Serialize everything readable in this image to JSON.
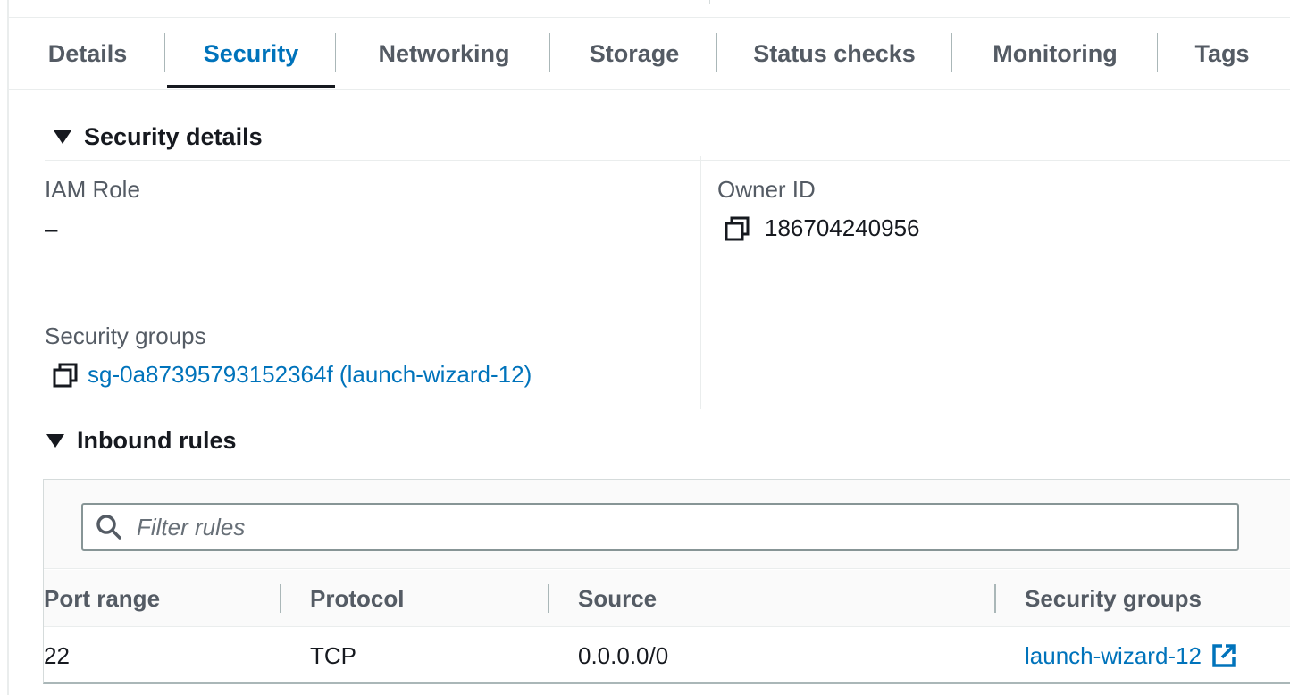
{
  "tabs": [
    {
      "label": "Details"
    },
    {
      "label": "Security"
    },
    {
      "label": "Networking"
    },
    {
      "label": "Storage"
    },
    {
      "label": "Status checks"
    },
    {
      "label": "Monitoring"
    },
    {
      "label": "Tags"
    }
  ],
  "active_tab": "Security",
  "security_details": {
    "header": "Security details",
    "iam_role_label": "IAM Role",
    "iam_role_value": "–",
    "owner_id_label": "Owner ID",
    "owner_id_value": "186704240956",
    "security_groups_label": "Security groups",
    "security_groups_value": "sg-0a87395793152364f (launch-wizard-12)"
  },
  "inbound_rules": {
    "header": "Inbound rules",
    "filter_placeholder": "Filter rules",
    "columns": [
      "Port range",
      "Protocol",
      "Source",
      "Security groups"
    ],
    "rows": [
      {
        "port_range": "22",
        "protocol": "TCP",
        "source": "0.0.0.0/0",
        "security_groups": "launch-wizard-12"
      }
    ]
  },
  "icons": {
    "copy": "copy-icon",
    "search": "search-icon",
    "external_link": "external-link-icon",
    "caret": "caret-down-icon"
  },
  "colors": {
    "link": "#0073bb",
    "text": "#16191f",
    "muted": "#545b64"
  }
}
